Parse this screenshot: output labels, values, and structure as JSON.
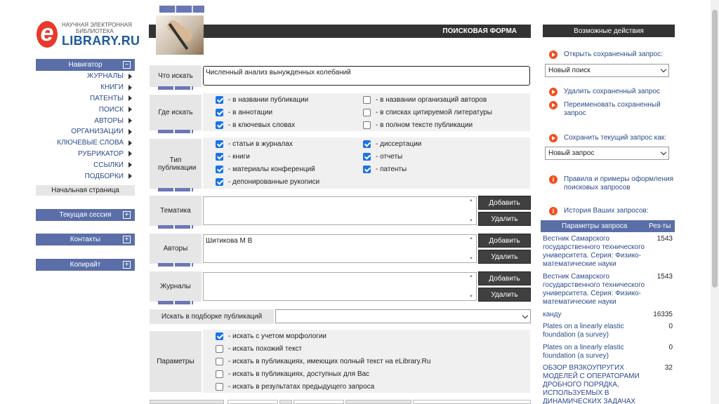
{
  "logo": {
    "line1": "НАУЧНАЯ ЭЛЕКТРОННАЯ",
    "line2": "БИБЛИОТЕКА",
    "brand": "LIBRARY.RU",
    "letter": "e"
  },
  "nav": {
    "header": "Навигатор",
    "collapse": "−",
    "items": [
      {
        "label": "ЖУРНАЛЫ"
      },
      {
        "label": "КНИГИ"
      },
      {
        "label": "ПАТЕНТЫ"
      },
      {
        "label": "ПОИСК"
      },
      {
        "label": "АВТОРЫ"
      },
      {
        "label": "ОРГАНИЗАЦИИ"
      },
      {
        "label": "КЛЮЧЕВЫЕ СЛОВА"
      },
      {
        "label": "РУБРИКАТОР"
      },
      {
        "label": "ССЫЛКИ"
      },
      {
        "label": "ПОДБОРКИ"
      }
    ],
    "home": "Начальная страница",
    "sections": [
      {
        "label": "Текущая сессия"
      },
      {
        "label": "Контакты"
      },
      {
        "label": "Копирайт"
      }
    ],
    "expand": "+"
  },
  "form": {
    "title": "ПОИСКОВАЯ ФОРМА",
    "query_label": "Что искать",
    "query_value": "Численный анализ вынужденных колебаний",
    "where_label": "Где искать",
    "where": [
      {
        "label": "- в названии публикации",
        "checked": true
      },
      {
        "label": "- в аннотации",
        "checked": true
      },
      {
        "label": "- в ключевых словах",
        "checked": true
      },
      {
        "label": "- в названии организаций авторов",
        "checked": false
      },
      {
        "label": "- в списках цитируемой литературы",
        "checked": false
      },
      {
        "label": "- в полном тексте публикации",
        "checked": false
      }
    ],
    "type_label": "Тип публикации",
    "types": [
      {
        "label": "- статьи в журналах",
        "checked": true
      },
      {
        "label": "- книги",
        "checked": true
      },
      {
        "label": "- материалы конференций",
        "checked": true
      },
      {
        "label": "- депонированные рукописи",
        "checked": true
      },
      {
        "label": "- диссертации",
        "checked": true
      },
      {
        "label": "- отчеты",
        "checked": true
      },
      {
        "label": "- патенты",
        "checked": true
      }
    ],
    "topic_label": "Тематика",
    "authors_label": "Авторы",
    "authors_value": "Шитикова М В",
    "journals_label": "Журналы",
    "add": "Добавить",
    "remove": "Удалить",
    "collection_label": "Искать в подборке публикаций",
    "collection_value": "",
    "params_label": "Параметры",
    "params": [
      {
        "label": "- искать с учетом морфологии",
        "checked": true
      },
      {
        "label": "- искать похожий текст",
        "checked": false
      },
      {
        "label": "- искать в публикациях, имеющих полный текст на eLibrary.Ru",
        "checked": false
      },
      {
        "label": "- искать в публикациях, доступных для Вас",
        "checked": false
      },
      {
        "label": "- искать в результатах предыдущего запроса",
        "checked": false
      }
    ]
  },
  "actions": {
    "title": "Возможные действия",
    "open": "Открыть сохраненный запрос:",
    "open_select": "Новый поиск",
    "delete": "Удалить сохраненный запрос",
    "rename": "Переименовать сохраненный запрос",
    "save": "Сохранить текущий запрос как:",
    "save_select": "Новый запрос",
    "rules": "Правила и примеры оформления поисковых запросов",
    "history": "История Ваших запросов:",
    "col_params": "Параметры запроса",
    "col_results": "Рез-ты",
    "rows": [
      {
        "q": "Вестник Самарского государственного технического университета. Серия: Физико-математические науки",
        "n": "1543"
      },
      {
        "q": "Вестник Самарского государственного технического университета. Серия: Физико-математические науки",
        "n": "1543"
      },
      {
        "q": "канду",
        "n": "16335"
      },
      {
        "q": "Plates on a linearly elastic foundation (a survey)",
        "n": "0"
      },
      {
        "q": "Plates on a linearly elastic foundation (a survey)",
        "n": "0"
      },
      {
        "q": "ОБЗОР ВЯЗКОУПРУГИХ МОДЕЛЕЙ С ОПЕРАТОРАМИ ДРОБНОГО ПОРЯДКА, ИСПОЛЬЗУЕМЫХ В ДИНАМИЧЕСКИХ ЗАДАЧАХ",
        "n": "32"
      }
    ]
  },
  "colors": {
    "accent": "#5a6ea8",
    "dark": "#333333",
    "link": "#2a4a8a",
    "icon": "#f05020",
    "checkbox": "#1a73e8"
  }
}
